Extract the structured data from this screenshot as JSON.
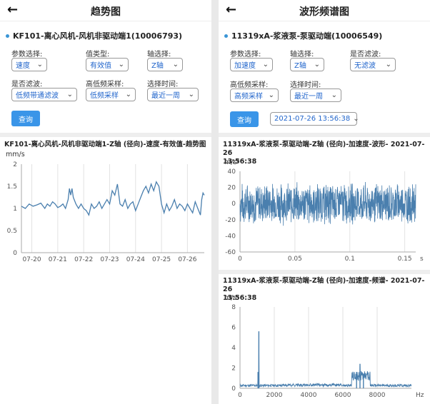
{
  "left": {
    "header": {
      "back_icon": "arrow-left-icon",
      "title": "趋势图"
    },
    "device": "KF101-离心风机-风机非驱动端1(10006793)",
    "filters": {
      "param_label": "参数选择:",
      "param_value": "速度",
      "valtype_label": "值类型:",
      "valtype_value": "有效值",
      "axis_label": "轴选择:",
      "axis_value": "Z轴",
      "filter_label": "是否滤波:",
      "filter_value": "低频带通滤波",
      "sampling_label": "高低频采样:",
      "sampling_value": "低频采样",
      "time_label": "选择时间:",
      "time_value": "最近一周"
    },
    "query_label": "查询",
    "chart_title": "KF101-离心风机-风机非驱动端1-Z轴 (径向)-速度-有效值-趋势图",
    "unit": "mm/s"
  },
  "right": {
    "header": {
      "back_icon": "arrow-left-icon",
      "title": "波形频谱图"
    },
    "device": "11319xA-浆液泵-泵驱动端(10006549)",
    "filters": {
      "param_label": "参数选择:",
      "param_value": "加速度",
      "axis_label": "轴选择:",
      "axis_value": "Z轴",
      "filter_label": "是否滤波:",
      "filter_value": "无滤波",
      "sampling_label": "高低频采样:",
      "sampling_value": "高频采样",
      "time_label": "选择时间:",
      "time_value": "最近一周"
    },
    "query_label": "查询",
    "datetime": "2021-07-26 13:56:38",
    "wave_title_1": "11319xA-浆液泵-泵驱动端-Z轴 (径向)-加速度-波形- 2021-07-26",
    "wave_title_2": "13:56:38",
    "wave_unit": "m/s²",
    "spec_title_1": "11319xA-浆液泵-泵驱动端-Z轴 (径向)-加速度-频谱- 2021-07-26",
    "spec_title_2": "13:56:38",
    "spec_unit": "m/s²"
  },
  "colors": {
    "accent": "#3a95e8",
    "series": "#4a7fae",
    "select_text": "#2266cc"
  },
  "chart_data": [
    {
      "type": "line",
      "title": "KF101-离心风机-风机非驱动端1-Z轴 (径向)-速度-有效值-趋势图",
      "ylabel": "mm/s",
      "ylim": [
        0,
        2
      ],
      "yticks": [
        0,
        0.5,
        1,
        1.5,
        2
      ],
      "xlim": [
        19.6,
        26.65
      ],
      "xticks": [
        20,
        21,
        22,
        23,
        24,
        25,
        26
      ],
      "xtick_labels": [
        "07-20",
        "07-21",
        "07-22",
        "07-23",
        "07-24",
        "07-25",
        "07-26"
      ],
      "grid": "vertical",
      "series": [
        {
          "x": [
            19.6,
            19.75,
            19.9,
            20.05,
            20.2,
            20.35,
            20.5,
            20.6,
            20.7,
            20.8,
            20.9,
            21.0,
            21.1,
            21.2,
            21.3,
            21.4,
            21.45,
            21.5,
            21.55,
            21.6,
            21.7,
            21.8,
            21.9,
            22.0,
            22.1,
            22.2,
            22.3,
            22.4,
            22.5,
            22.6,
            22.7,
            22.8,
            22.9,
            23.0,
            23.1,
            23.2,
            23.3,
            23.4,
            23.5,
            23.6,
            23.7,
            23.8,
            23.9,
            24.0,
            24.1,
            24.2,
            24.3,
            24.4,
            24.5,
            24.6,
            24.7,
            24.8,
            24.9,
            25.0,
            25.1,
            25.2,
            25.3,
            25.4,
            25.5,
            25.6,
            25.7,
            25.8,
            25.9,
            26.0,
            26.1,
            26.2,
            26.3,
            26.4,
            26.5,
            26.55,
            26.6,
            26.65
          ],
          "y": [
            1.05,
            1.0,
            1.1,
            1.05,
            1.08,
            1.12,
            1.0,
            1.1,
            1.05,
            1.15,
            1.1,
            1.02,
            1.05,
            1.1,
            1.0,
            1.2,
            1.45,
            1.3,
            1.45,
            1.25,
            1.1,
            1.0,
            1.1,
            1.0,
            0.95,
            0.85,
            1.1,
            1.0,
            1.05,
            1.15,
            1.0,
            1.1,
            1.2,
            1.1,
            1.4,
            1.3,
            1.55,
            1.1,
            1.05,
            1.2,
            1.0,
            1.1,
            1.15,
            0.95,
            1.1,
            1.25,
            1.4,
            1.5,
            1.35,
            1.55,
            1.4,
            1.6,
            1.5,
            1.1,
            0.9,
            1.1,
            0.95,
            1.05,
            1.2,
            1.0,
            1.1,
            1.05,
            0.95,
            1.1,
            1.0,
            0.9,
            1.15,
            1.0,
            0.85,
            1.2,
            1.35,
            1.3
          ]
        }
      ]
    },
    {
      "type": "line",
      "title": "11319xA-浆液泵-泵驱动端-Z轴 (径向)-加速度-波形- 2021-07-26 13:56:38",
      "ylabel": "m/s²",
      "xlabel": "s",
      "ylim": [
        -60,
        40
      ],
      "yticks": [
        -60,
        -40,
        -20,
        0,
        20,
        40
      ],
      "xlim": [
        0,
        0.16
      ],
      "xticks": [
        0,
        0.05,
        0.1,
        0.15
      ],
      "envelope_amplitude": 28,
      "grid": "vertical"
    },
    {
      "type": "line",
      "title": "11319xA-浆液泵-泵驱动端-Z轴 (径向)-加速度-频谱- 2021-07-26 13:56:38",
      "ylabel": "m/s²",
      "xlabel": "Hz",
      "ylim": [
        0,
        8
      ],
      "yticks": [
        0,
        2,
        4,
        6,
        8
      ],
      "xlim": [
        0,
        10000
      ],
      "xticks": [
        0,
        2000,
        4000,
        6000,
        8000
      ],
      "grid": "vertical",
      "peaks": [
        {
          "x": 1100,
          "y": 5.6
        },
        {
          "x": 1050,
          "y": 1.6
        },
        {
          "x": 7000,
          "y": 2.4
        },
        {
          "x": 6800,
          "y": 1.6
        },
        {
          "x": 7200,
          "y": 1.4
        }
      ]
    }
  ]
}
